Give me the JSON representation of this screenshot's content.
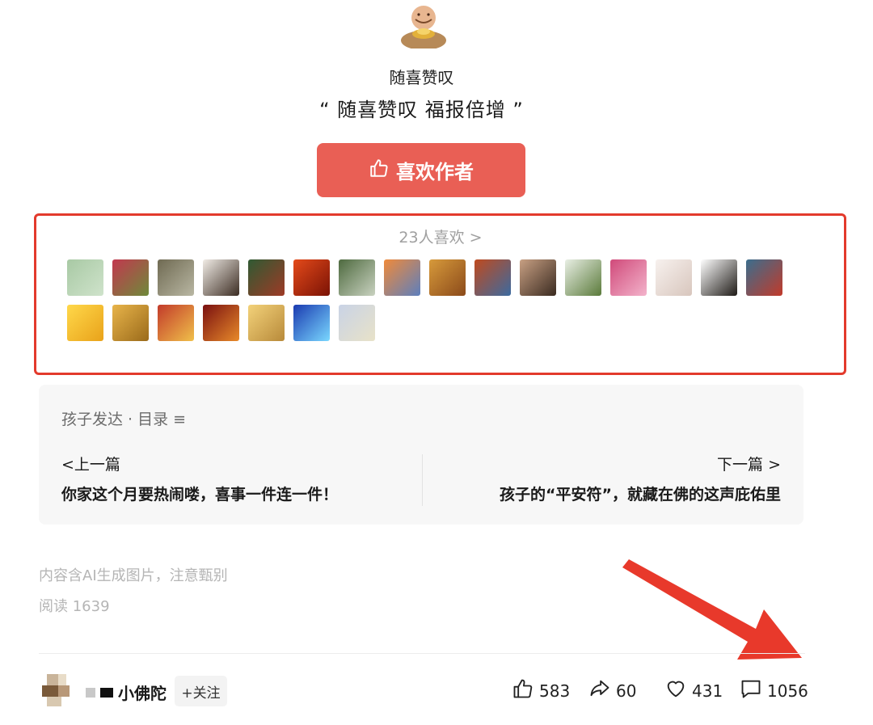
{
  "author": {
    "avatar_icon": "smiling-buddha-avatar",
    "name": "随喜赞叹",
    "quote": "“  随喜赞叹 福报倍增  ”"
  },
  "like_author_button": {
    "icon": "thumb-up-icon",
    "label": "喜欢作者"
  },
  "likers": {
    "count_label": "23人喜欢 >",
    "avatars": [
      {
        "label": "liker-1",
        "colors": [
          "#a8c9a4",
          "#cfe3cb"
        ]
      },
      {
        "label": "liker-2",
        "colors": [
          "#c2384f",
          "#6e8a3a"
        ]
      },
      {
        "label": "liker-3",
        "colors": [
          "#6f6a52",
          "#b9b7a3"
        ]
      },
      {
        "label": "liker-4",
        "colors": [
          "#f1ece6",
          "#3b2c22"
        ]
      },
      {
        "label": "liker-5",
        "colors": [
          "#2f5a33",
          "#9e3a26"
        ]
      },
      {
        "label": "liker-6",
        "colors": [
          "#e44a1a",
          "#7a1205"
        ]
      },
      {
        "label": "liker-7",
        "colors": [
          "#4e6a3f",
          "#c9d2c0"
        ]
      },
      {
        "label": "liker-8",
        "colors": [
          "#f08a3a",
          "#5c7fbe"
        ]
      },
      {
        "label": "liker-9",
        "colors": [
          "#d79a3b",
          "#8b4a1a"
        ]
      },
      {
        "label": "liker-10",
        "colors": [
          "#c04a1e",
          "#3b6aa0"
        ]
      },
      {
        "label": "liker-11",
        "colors": [
          "#c8a083",
          "#3a2a20"
        ]
      },
      {
        "label": "liker-12",
        "colors": [
          "#e9efe5",
          "#5a7a3a"
        ]
      },
      {
        "label": "liker-13",
        "colors": [
          "#d04a7a",
          "#f3b3cb"
        ]
      },
      {
        "label": "liker-14",
        "colors": [
          "#f7f1ee",
          "#d8c6bd"
        ]
      },
      {
        "label": "liker-15",
        "colors": [
          "#ffffff",
          "#1e1a16"
        ]
      },
      {
        "label": "liker-16",
        "colors": [
          "#3a6e8e",
          "#c23a2a"
        ]
      },
      {
        "label": "liker-17",
        "colors": [
          "#ffd84a",
          "#e9a21a"
        ]
      },
      {
        "label": "liker-18",
        "colors": [
          "#e8b44a",
          "#9a6a1a"
        ]
      },
      {
        "label": "liker-19",
        "colors": [
          "#c23a2a",
          "#f0c04a"
        ]
      },
      {
        "label": "liker-20",
        "colors": [
          "#7a1010",
          "#e88a2a"
        ]
      },
      {
        "label": "liker-21",
        "colors": [
          "#f3d27a",
          "#b88a3a"
        ]
      },
      {
        "label": "liker-22",
        "colors": [
          "#1a3ab0",
          "#7ad8ff"
        ]
      },
      {
        "label": "liker-23",
        "colors": [
          "#c9d3e6",
          "#e8e2c8"
        ]
      }
    ]
  },
  "toc": {
    "header": "孩子发达 · 目录 ≡",
    "prev_label": "<上一篇",
    "prev_title": "你家这个月要热闹喽，喜事一件连一件！",
    "next_label": "下一篇 >",
    "next_title": "孩子的“平安符”，就藏在佛的这声庇佑里"
  },
  "ai_notice": "内容含AI生成图片，注意甄别",
  "read_count": "阅读 1639",
  "footer": {
    "account_name": "小佛陀",
    "follow_label": "+关注",
    "likes": "583",
    "shares": "60",
    "favorites": "431",
    "comments": "1056"
  },
  "colors": {
    "accent_red": "#e95f55",
    "highlight_border": "#e33a2c",
    "annotation_arrow": "#e8392b"
  }
}
